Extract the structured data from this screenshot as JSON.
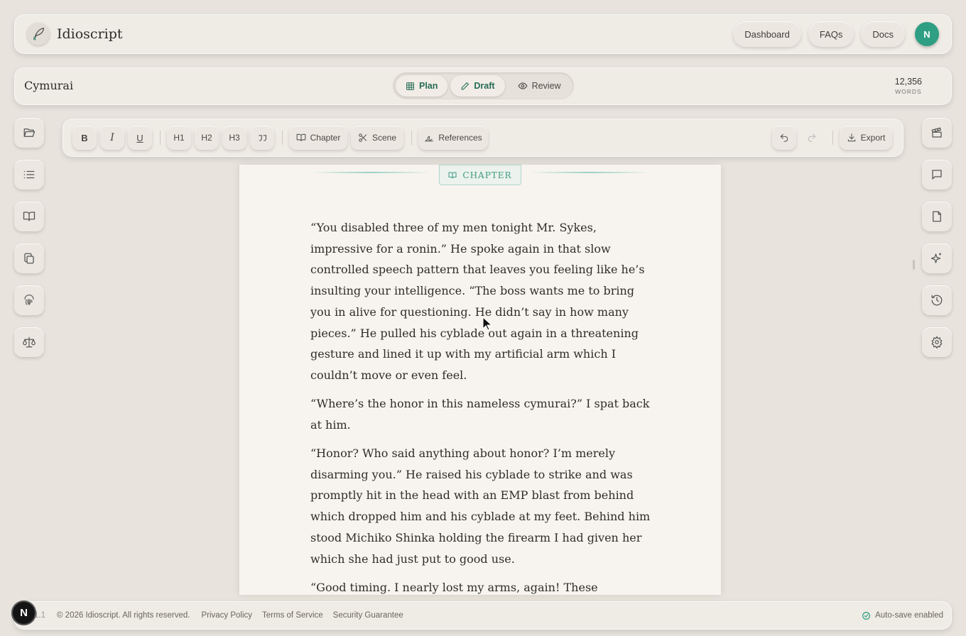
{
  "app": {
    "name": "Idioscript",
    "avatar_initial": "N"
  },
  "nav": {
    "dashboard": "Dashboard",
    "faqs": "FAQs",
    "docs": "Docs"
  },
  "project": {
    "title": "Cymurai",
    "word_count": "12,356",
    "word_label": "WORDS"
  },
  "modes": [
    {
      "label": "Plan",
      "icon": "grid-icon"
    },
    {
      "label": "Draft",
      "icon": "pencil-icon",
      "active": true
    },
    {
      "label": "Review",
      "icon": "eye-icon"
    }
  ],
  "toolbar": {
    "bold": "B",
    "italic": "I",
    "underline": "U",
    "h1": "H1",
    "h2": "H2",
    "h3": "H3",
    "chapter": "Chapter",
    "scene": "Scene",
    "references": "References",
    "export": "Export"
  },
  "left_sidebar": [
    "folder-icon",
    "list-icon",
    "book-icon",
    "copy-icon",
    "fingerprint-icon",
    "scales-icon"
  ],
  "right_sidebar": [
    "clapperboard-icon",
    "comment-icon",
    "note-icon",
    "sparkle-icon",
    "history-icon",
    "settings-icon"
  ],
  "editor": {
    "chapter_label": "CHAPTER",
    "paragraphs": [
      "“You disabled three of my men tonight Mr. Sykes, impressive for a ronin.” He spoke again in that slow controlled speech pattern that leaves you feeling like he’s insulting your intelligence. “The boss wants me to bring you in alive for questioning. He didn’t say in how many pieces.” He pulled his cyblade out again in a threatening gesture and lined it up with my artificial arm which I couldn’t move or even feel.",
      "“Where’s the honor in this nameless cymurai?” I spat back at him.",
      "“Honor? Who said anything about honor? I’m merely disarming you.” He raised his cyblade to strike and was promptly hit in the head with an EMP blast from behind which dropped him and his cyblade at my feet. Behind him stood Michiko Shinka holding the firearm I had given her which she had just put to good use.",
      "“Good timing. I nearly lost my arms, again! These shocking"
    ]
  },
  "footer": {
    "version": "1.1",
    "copyright": "© 2026 Idioscript. All rights reserved.",
    "privacy": "Privacy Policy",
    "terms": "Terms of Service",
    "security": "Security Guarantee",
    "autosave": "Auto-save enabled"
  },
  "colors": {
    "accent": "#2e9f83",
    "background": "#e8e4dd",
    "page": "#f7f4ef"
  }
}
